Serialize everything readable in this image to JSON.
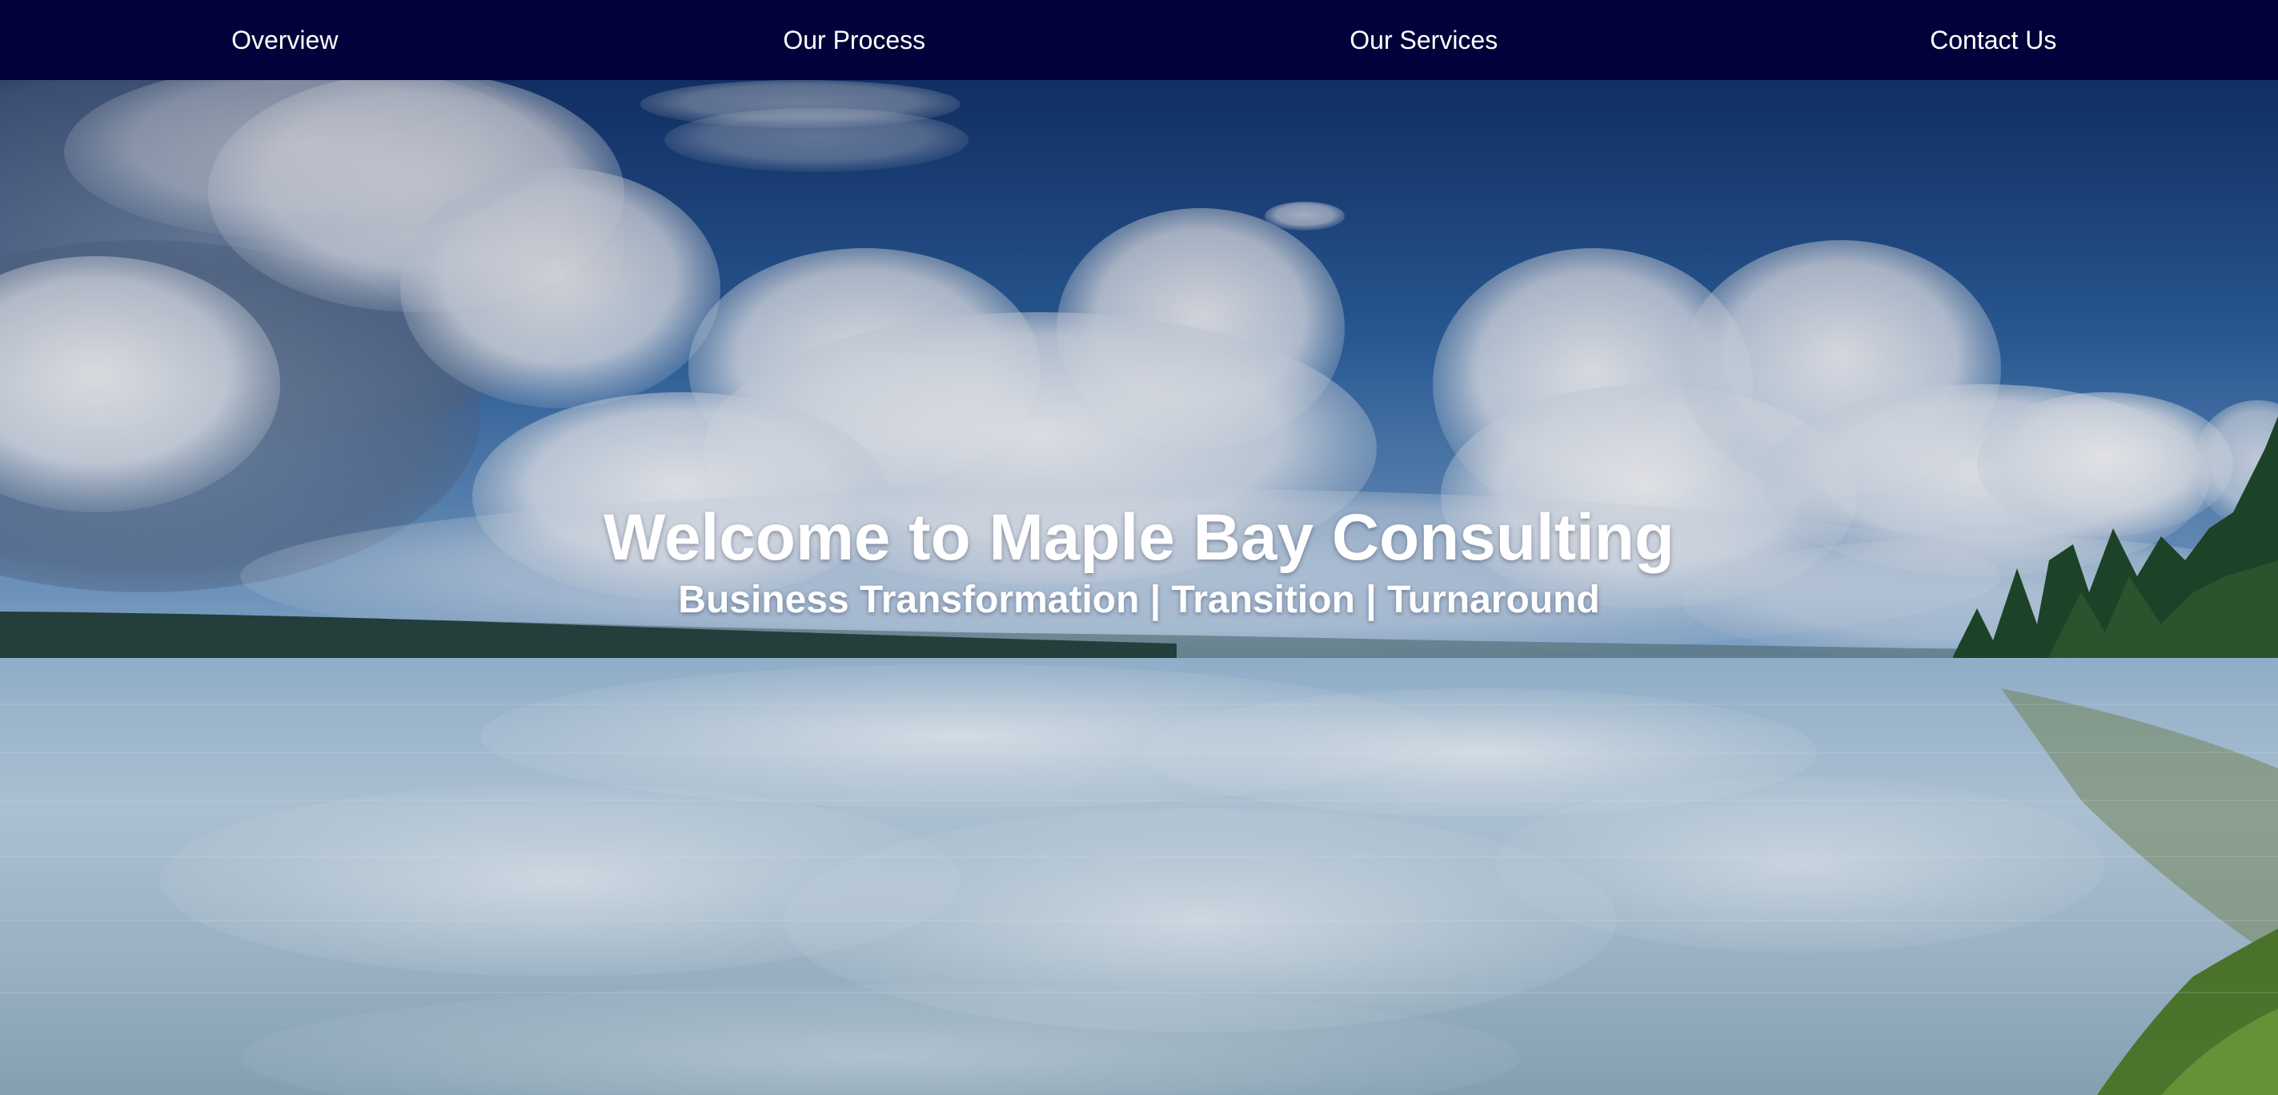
{
  "nav": {
    "items": [
      {
        "label": "Overview"
      },
      {
        "label": "Our Process"
      },
      {
        "label": "Our Services"
      },
      {
        "label": "Contact Us"
      }
    ]
  },
  "hero": {
    "title": "Welcome to Maple Bay Consulting",
    "subtitle": "Business Transformation | Transition | Turnaround",
    "background_image": "lake-and-cloudy-sky-photo"
  },
  "colors": {
    "nav_background": "#02023a",
    "nav_text": "#ffffff",
    "hero_text": "#ffffff",
    "sky_top": "#163e78",
    "water": "#a9c6dc"
  }
}
